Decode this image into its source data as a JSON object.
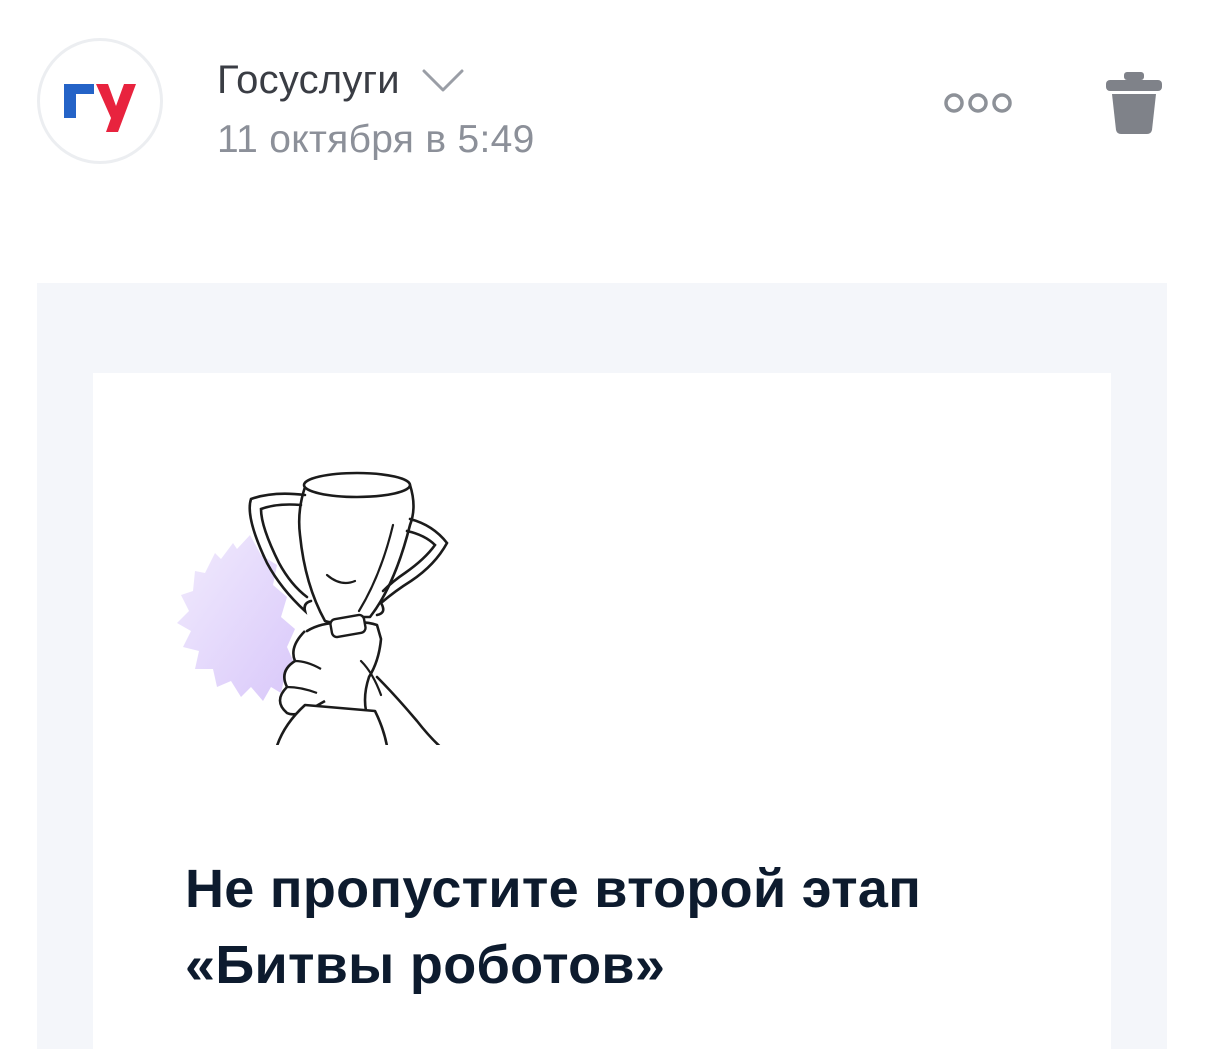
{
  "header": {
    "avatar_icon": "gosuslugi-logo",
    "sender_name": "Госуслуги",
    "sender_chevron_icon": "chevron-down-icon",
    "date": "11 октября в 5:49",
    "more_icon": "more-dots-icon",
    "delete_icon": "trash-icon"
  },
  "email": {
    "illustration": "trophy-in-hand",
    "headline": "Не пропустите второй этап «Битвы роботов»"
  },
  "colors": {
    "logo_blue": "#2463c7",
    "logo_red": "#e8233e",
    "headline": "#0d1b2e",
    "frame_bg": "#f4f6fa",
    "accent_lilac": "#e3d6fb"
  }
}
